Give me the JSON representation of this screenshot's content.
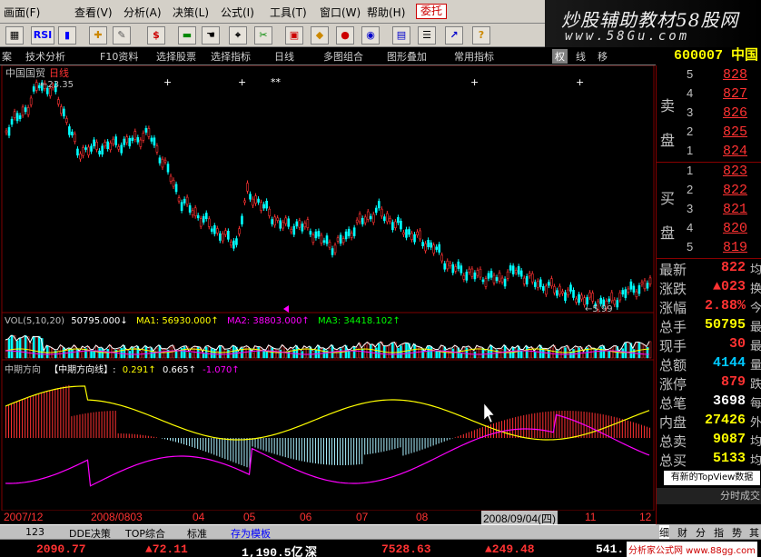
{
  "menu": {
    "items": [
      "画面(F)",
      "查看(V)",
      "分析(A)",
      "决策(L)",
      "公式(I)",
      "工具(T)",
      "窗口(W)",
      "帮助(H)"
    ]
  },
  "weituo": "委托",
  "brand": {
    "line1": "炒股辅助教材58股网",
    "line2": "www.58Gu.com"
  },
  "toolbar": {
    "rsi": "RSI",
    "dollar": "$"
  },
  "tabs": [
    "案",
    "技术分析",
    "F10资料",
    "选择股票",
    "选择指标",
    "日线",
    "多图组合",
    "图形叠加",
    "常用指标",
    "权",
    "线",
    "移"
  ],
  "code": "600007 中国",
  "chart": {
    "stock_name": "中国国贸",
    "period": "日线",
    "high_label": "23.35",
    "low_label": "5.99",
    "vol_title": "VOL(5,10,20)",
    "vol_value": "50795.000↓",
    "vol_ma1": "MA1: 56930.000↑",
    "vol_ma2": "MA2: 38803.000↑",
    "vol_ma3": "MA3: 34418.102↑",
    "ind_title": "中期方向",
    "ind_line": "【中期方向线】:",
    "ind_v1": "0.291↑",
    "ind_v2": "0.665↑",
    "ind_v3": "-1.070↑",
    "xaxis": [
      "2007/12",
      "2008/0803",
      "04",
      "05",
      "06",
      "07",
      "08",
      "11",
      "12"
    ],
    "date_box": "2008/09/04(四)"
  },
  "quote": {
    "sell_label": [
      "卖",
      "盘"
    ],
    "buy_label": [
      "买",
      "盘"
    ],
    "sell": [
      {
        "lvl": "5",
        "price": "828"
      },
      {
        "lvl": "4",
        "price": "827"
      },
      {
        "lvl": "3",
        "price": "826"
      },
      {
        "lvl": "2",
        "price": "825"
      },
      {
        "lvl": "1",
        "price": "824"
      }
    ],
    "buy": [
      {
        "lvl": "1",
        "price": "823"
      },
      {
        "lvl": "2",
        "price": "822"
      },
      {
        "lvl": "3",
        "price": "821"
      },
      {
        "lvl": "4",
        "price": "820"
      },
      {
        "lvl": "5",
        "price": "819"
      }
    ],
    "rows": [
      {
        "label": "最新",
        "value": "822",
        "end": "均"
      },
      {
        "label": "涨跌",
        "value": "▲023",
        "end": "换"
      },
      {
        "label": "涨幅",
        "value": "2.88%",
        "end": "今"
      },
      {
        "label": "总手",
        "value": "50795",
        "end": "最"
      },
      {
        "label": "现手",
        "value": "30",
        "end": "最"
      },
      {
        "label": "总额",
        "value": "4144",
        "end": "量"
      },
      {
        "label": "涨停",
        "value": "879",
        "end": "跌"
      },
      {
        "label": "总笔",
        "value": "3698",
        "end": "每"
      },
      {
        "label": "内盘",
        "value": "27426",
        "end": "外"
      },
      {
        "label": "总卖",
        "value": "9087",
        "end": "均"
      },
      {
        "label": "总买",
        "value": "5133",
        "end": "均"
      }
    ],
    "topview": "有新的TopView数据",
    "fenshi": "分时成交"
  },
  "bottom_tabs": [
    "123",
    "DDE决策",
    "TOP综合",
    "标准",
    "存为模板"
  ],
  "right_tabs": [
    "细",
    "财",
    "分",
    "指",
    "势",
    "其"
  ],
  "status": [
    {
      "text": "2090.77",
      "color": "red"
    },
    {
      "text": "▲72.11",
      "color": "red"
    },
    {
      "text": "1,190.5亿",
      "color": "wht"
    },
    {
      "text": "深",
      "color": "wht"
    },
    {
      "text": "7528.63",
      "color": "red"
    },
    {
      "text": "▲249.48",
      "color": "red"
    },
    {
      "text": "541.",
      "color": "wht"
    }
  ],
  "watermark": "分析家公式网 www.88gg.com"
}
